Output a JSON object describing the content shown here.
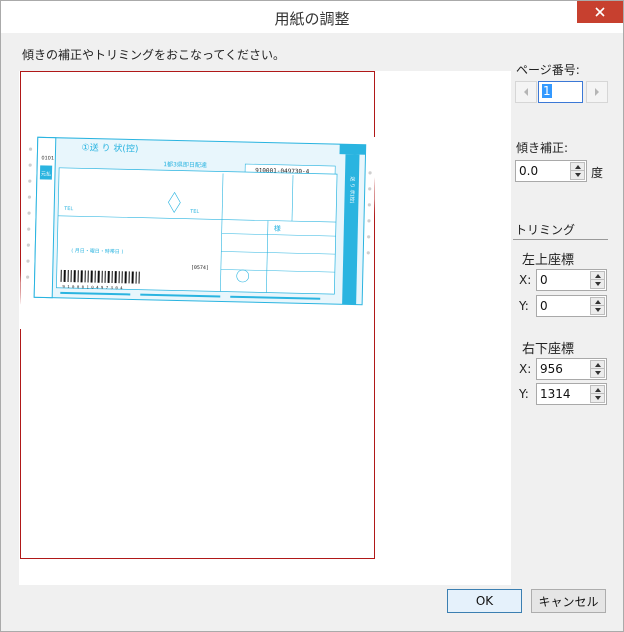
{
  "window": {
    "title": "用紙の調整"
  },
  "instruction": "傾きの補正やトリミングをおこなってください。",
  "page_number": {
    "label": "ページ番号:",
    "value": "1"
  },
  "skew": {
    "label": "傾き補正:",
    "value": "0.0",
    "unit": "度"
  },
  "trimming": {
    "label": "トリミング",
    "top_left": {
      "label": "左上座標",
      "x_label": "X:",
      "x": "0",
      "y_label": "Y:",
      "y": "0"
    },
    "bottom_right": {
      "label": "右下座標",
      "x_label": "X:",
      "x": "956",
      "y_label": "Y:",
      "y": "1314"
    }
  },
  "buttons": {
    "ok": "OK",
    "cancel": "キャンセル"
  },
  "slip": {
    "title": "①送 り 状(控)",
    "service": "1都3県即日配達",
    "tracking": "910001-049730-4",
    "code": "0101",
    "side_label": "送 り 状(控)",
    "box_label": "元払",
    "tel": "TEL",
    "sama": "様",
    "date_line": "(  月日・曜日・時帯日 )",
    "number_tag": "[0574]",
    "barcode_digits": "9 1 0 0 0 1 0 4 9 7 3 0 4"
  },
  "colors": {
    "slip_cyan": "#2ab4e0",
    "slip_fill": "#dff3fb",
    "frame_red": "#b01818",
    "close_red": "#c7402f"
  }
}
